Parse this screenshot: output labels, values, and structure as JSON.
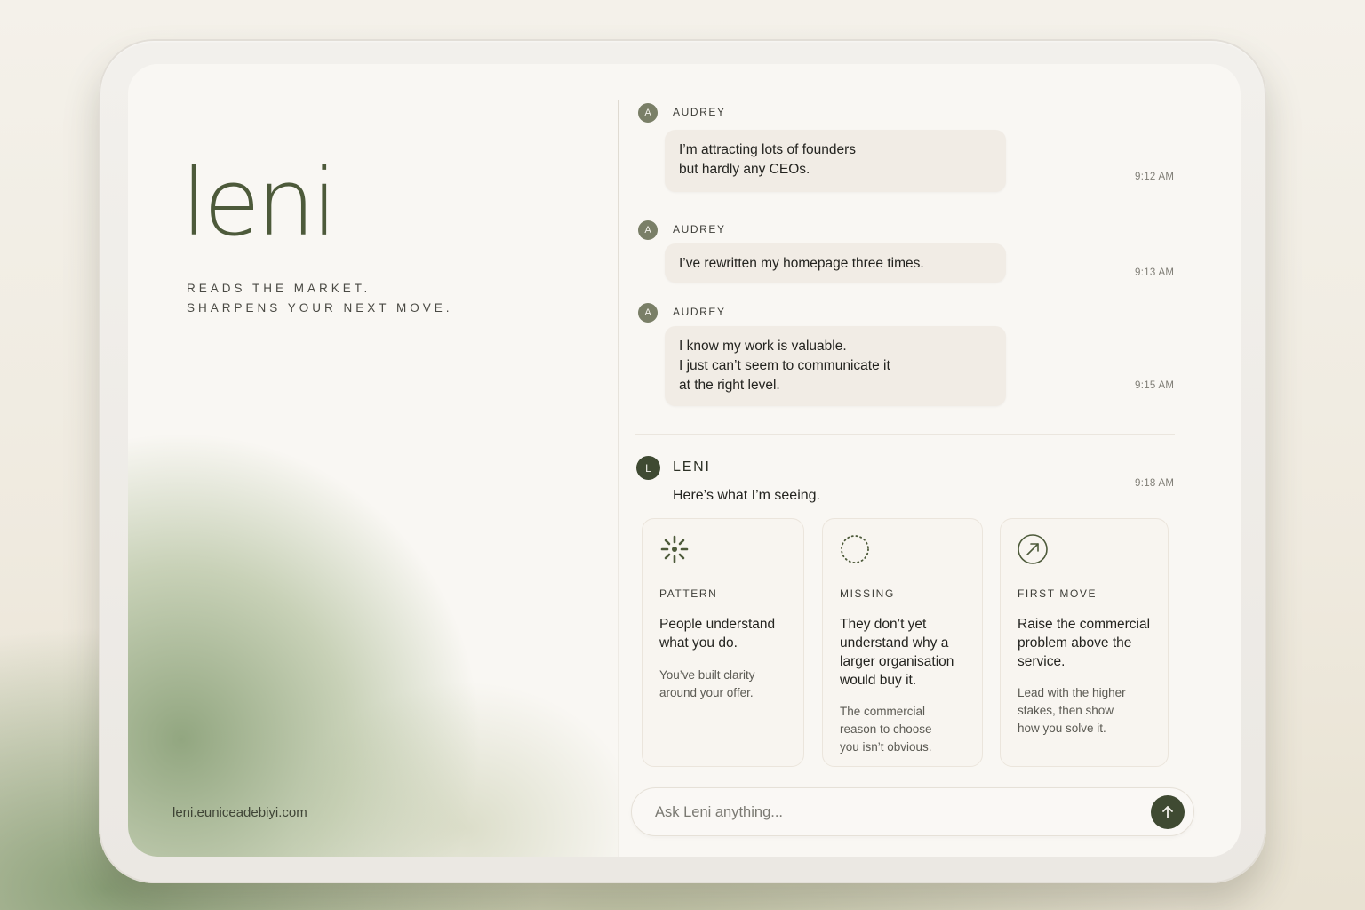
{
  "brand": {
    "name": "leni",
    "tagline": [
      "READS THE MARKET.",
      "SHARPENS YOUR NEXT MOVE."
    ],
    "url": "leni.euniceadebiyi.com"
  },
  "messages": [
    {
      "avatar": "A",
      "sender": "AUDREY",
      "lines": [
        "I’m attracting lots of founders",
        "but hardly any CEOs."
      ],
      "time": "9:12 AM"
    },
    {
      "avatar": "A",
      "sender": "AUDREY",
      "lines": [
        "I’ve rewritten my homepage three times."
      ],
      "time": "9:13 AM"
    },
    {
      "avatar": "A",
      "sender": "AUDREY",
      "lines": [
        "I know my work is valuable.",
        "I just can’t seem to communicate it",
        "at the right level."
      ],
      "time": "9:15 AM"
    }
  ],
  "reply": {
    "avatar": "L",
    "sender": "LENI",
    "intro": "Here’s what I’m seeing.",
    "time": "9:18 AM",
    "cards": [
      {
        "icon": "spark-icon",
        "label": "PATTERN",
        "headline": [
          "People understand",
          "what you do."
        ],
        "body": [
          "You’ve built clarity",
          "around your offer."
        ]
      },
      {
        "icon": "dotted-circle-icon",
        "label": "MISSING",
        "headline": [
          "They don’t yet",
          "understand why a",
          "larger organisation",
          "would buy it."
        ],
        "body": [
          "The commercial",
          "reason to choose",
          "you isn’t obvious."
        ]
      },
      {
        "icon": "arrow-up-right-circle-icon",
        "label": "FIRST MOVE",
        "headline": [
          "Raise the commercial",
          "problem above the",
          "service."
        ],
        "body": [
          "Lead with the higher",
          "stakes, then show",
          "how you solve it."
        ]
      }
    ]
  },
  "composer": {
    "placeholder": "Ask Leni anything...",
    "send_icon": "arrow-up-icon"
  },
  "colors": {
    "accent": "#3f4a32",
    "brand_text": "#4d5a3a",
    "bubble": "#f1ece5"
  }
}
